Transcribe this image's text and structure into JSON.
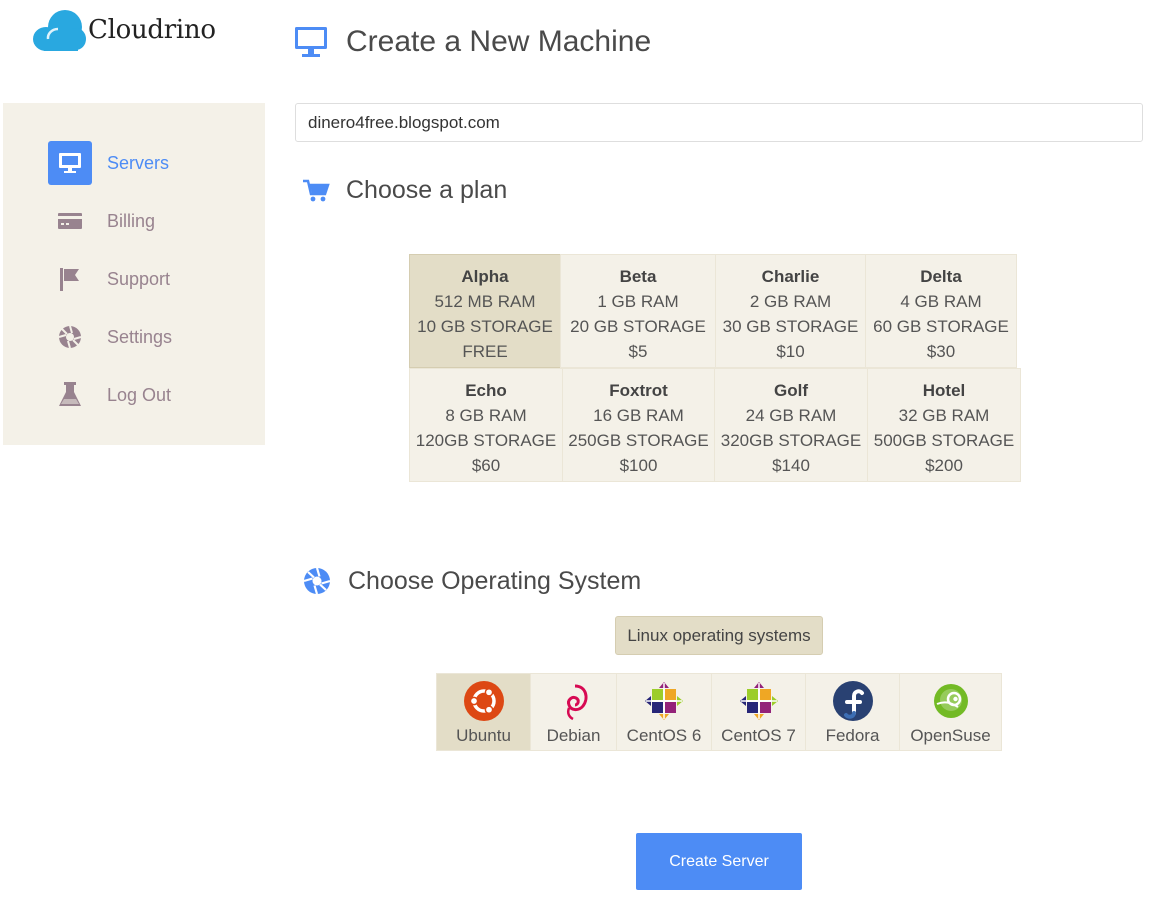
{
  "brand": {
    "name": "Cloudrino",
    "accent": "#4d8cf5"
  },
  "sidebar": {
    "items": [
      {
        "label": "Servers",
        "icon": "monitor-icon",
        "active": true
      },
      {
        "label": "Billing",
        "icon": "credit-card-icon"
      },
      {
        "label": "Support",
        "icon": "flag-icon"
      },
      {
        "label": "Settings",
        "icon": "aperture-icon"
      },
      {
        "label": "Log Out",
        "icon": "flask-icon"
      }
    ]
  },
  "header": {
    "title": "Create a New Machine",
    "icon": "monitor-icon"
  },
  "hostname": {
    "value": "dinero4free.blogspot.com"
  },
  "plans_section": {
    "title": "Choose a plan",
    "icon": "cart-icon"
  },
  "plans": [
    {
      "name": "Alpha",
      "ram": "512 MB RAM",
      "storage": "10 GB STORAGE",
      "price": "FREE",
      "selected": true
    },
    {
      "name": "Beta",
      "ram": "1 GB RAM",
      "storage": "20 GB STORAGE",
      "price": "$5"
    },
    {
      "name": "Charlie",
      "ram": "2 GB RAM",
      "storage": "30 GB STORAGE",
      "price": "$10"
    },
    {
      "name": "Delta",
      "ram": "4 GB RAM",
      "storage": "60 GB STORAGE",
      "price": "$30"
    },
    {
      "name": "Echo",
      "ram": "8 GB RAM",
      "storage": "120GB STORAGE",
      "price": "$60"
    },
    {
      "name": "Foxtrot",
      "ram": "16 GB RAM",
      "storage": "250GB STORAGE",
      "price": "$100"
    },
    {
      "name": "Golf",
      "ram": "24 GB RAM",
      "storage": "320GB STORAGE",
      "price": "$140"
    },
    {
      "name": "Hotel",
      "ram": "32 GB RAM",
      "storage": "500GB STORAGE",
      "price": "$200"
    }
  ],
  "os_section": {
    "title": "Choose Operating System",
    "icon": "aperture-icon",
    "category": "Linux operating systems"
  },
  "os_list": [
    {
      "label": "Ubuntu",
      "icon": "ubuntu-icon",
      "selected": true
    },
    {
      "label": "Debian",
      "icon": "debian-icon"
    },
    {
      "label": "CentOS 6",
      "icon": "centos-icon"
    },
    {
      "label": "CentOS 7",
      "icon": "centos-icon"
    },
    {
      "label": "Fedora",
      "icon": "fedora-icon"
    },
    {
      "label": "OpenSuse",
      "icon": "opensuse-icon"
    }
  ],
  "actions": {
    "create_label": "Create Server"
  }
}
